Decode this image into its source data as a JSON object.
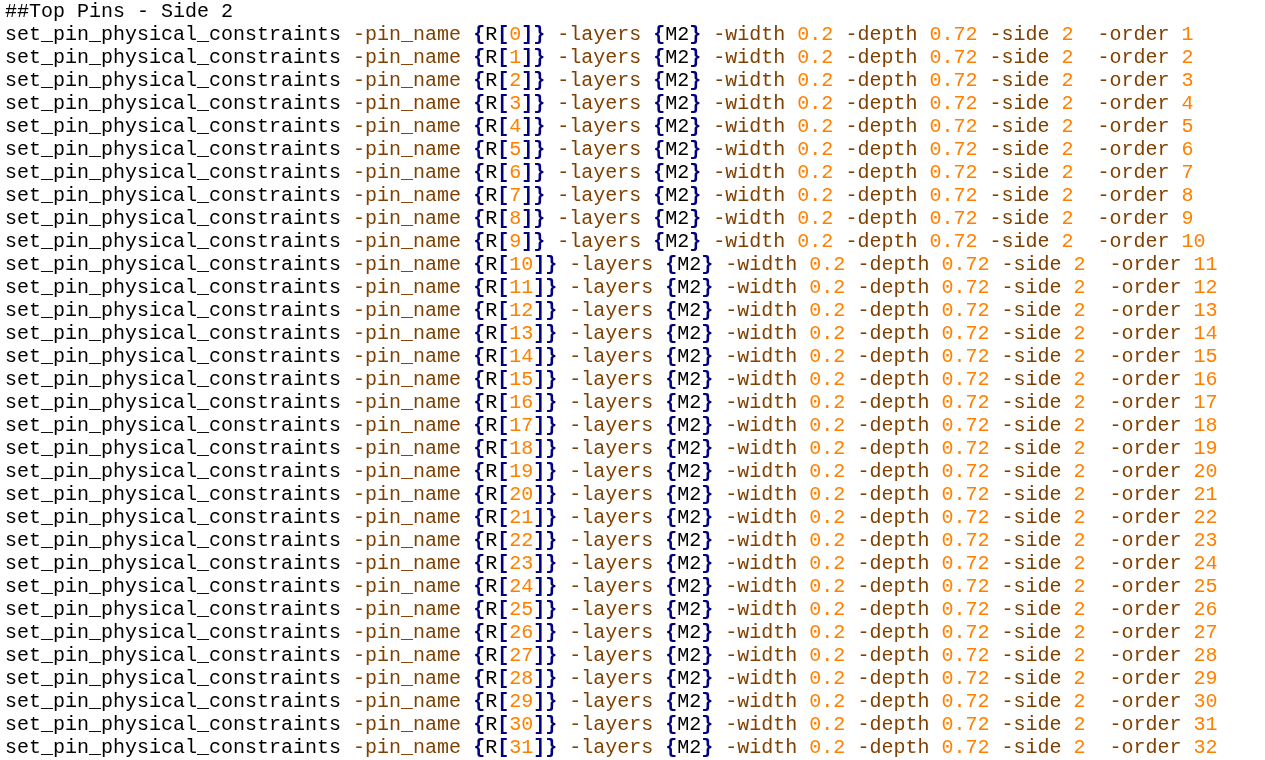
{
  "editor": {
    "lines": [
      {
        "kind": "comment",
        "text": "##Top Pins - Side 2"
      },
      {
        "kind": "command",
        "text": "set_pin_physical_constraints -pin_name {R[0]} -layers {M2} -width 0.2 -depth 0.72 -side 2  -order 1"
      },
      {
        "kind": "command",
        "text": "set_pin_physical_constraints -pin_name {R[1]} -layers {M2} -width 0.2 -depth 0.72 -side 2  -order 2"
      },
      {
        "kind": "command",
        "text": "set_pin_physical_constraints -pin_name {R[2]} -layers {M2} -width 0.2 -depth 0.72 -side 2  -order 3"
      },
      {
        "kind": "command",
        "text": "set_pin_physical_constraints -pin_name {R[3]} -layers {M2} -width 0.2 -depth 0.72 -side 2  -order 4"
      },
      {
        "kind": "command",
        "text": "set_pin_physical_constraints -pin_name {R[4]} -layers {M2} -width 0.2 -depth 0.72 -side 2  -order 5"
      },
      {
        "kind": "command",
        "text": "set_pin_physical_constraints -pin_name {R[5]} -layers {M2} -width 0.2 -depth 0.72 -side 2  -order 6"
      },
      {
        "kind": "command",
        "text": "set_pin_physical_constraints -pin_name {R[6]} -layers {M2} -width 0.2 -depth 0.72 -side 2  -order 7"
      },
      {
        "kind": "command",
        "text": "set_pin_physical_constraints -pin_name {R[7]} -layers {M2} -width 0.2 -depth 0.72 -side 2  -order 8"
      },
      {
        "kind": "command",
        "text": "set_pin_physical_constraints -pin_name {R[8]} -layers {M2} -width 0.2 -depth 0.72 -side 2  -order 9"
      },
      {
        "kind": "command",
        "text": "set_pin_physical_constraints -pin_name {R[9]} -layers {M2} -width 0.2 -depth 0.72 -side 2  -order 10"
      },
      {
        "kind": "command",
        "text": "set_pin_physical_constraints -pin_name {R[10]} -layers {M2} -width 0.2 -depth 0.72 -side 2  -order 11"
      },
      {
        "kind": "command",
        "text": "set_pin_physical_constraints -pin_name {R[11]} -layers {M2} -width 0.2 -depth 0.72 -side 2  -order 12"
      },
      {
        "kind": "command",
        "text": "set_pin_physical_constraints -pin_name {R[12]} -layers {M2} -width 0.2 -depth 0.72 -side 2  -order 13"
      },
      {
        "kind": "command",
        "text": "set_pin_physical_constraints -pin_name {R[13]} -layers {M2} -width 0.2 -depth 0.72 -side 2  -order 14"
      },
      {
        "kind": "command",
        "text": "set_pin_physical_constraints -pin_name {R[14]} -layers {M2} -width 0.2 -depth 0.72 -side 2  -order 15"
      },
      {
        "kind": "command",
        "text": "set_pin_physical_constraints -pin_name {R[15]} -layers {M2} -width 0.2 -depth 0.72 -side 2  -order 16"
      },
      {
        "kind": "command",
        "text": "set_pin_physical_constraints -pin_name {R[16]} -layers {M2} -width 0.2 -depth 0.72 -side 2  -order 17"
      },
      {
        "kind": "command",
        "text": "set_pin_physical_constraints -pin_name {R[17]} -layers {M2} -width 0.2 -depth 0.72 -side 2  -order 18"
      },
      {
        "kind": "command",
        "text": "set_pin_physical_constraints -pin_name {R[18]} -layers {M2} -width 0.2 -depth 0.72 -side 2  -order 19"
      },
      {
        "kind": "command",
        "text": "set_pin_physical_constraints -pin_name {R[19]} -layers {M2} -width 0.2 -depth 0.72 -side 2  -order 20"
      },
      {
        "kind": "command",
        "text": "set_pin_physical_constraints -pin_name {R[20]} -layers {M2} -width 0.2 -depth 0.72 -side 2  -order 21"
      },
      {
        "kind": "command",
        "text": "set_pin_physical_constraints -pin_name {R[21]} -layers {M2} -width 0.2 -depth 0.72 -side 2  -order 22"
      },
      {
        "kind": "command",
        "text": "set_pin_physical_constraints -pin_name {R[22]} -layers {M2} -width 0.2 -depth 0.72 -side 2  -order 23"
      },
      {
        "kind": "command",
        "text": "set_pin_physical_constraints -pin_name {R[23]} -layers {M2} -width 0.2 -depth 0.72 -side 2  -order 24"
      },
      {
        "kind": "command",
        "text": "set_pin_physical_constraints -pin_name {R[24]} -layers {M2} -width 0.2 -depth 0.72 -side 2  -order 25"
      },
      {
        "kind": "command",
        "text": "set_pin_physical_constraints -pin_name {R[25]} -layers {M2} -width 0.2 -depth 0.72 -side 2  -order 26"
      },
      {
        "kind": "command",
        "text": "set_pin_physical_constraints -pin_name {R[26]} -layers {M2} -width 0.2 -depth 0.72 -side 2  -order 27"
      },
      {
        "kind": "command",
        "text": "set_pin_physical_constraints -pin_name {R[27]} -layers {M2} -width 0.2 -depth 0.72 -side 2  -order 28"
      },
      {
        "kind": "command",
        "text": "set_pin_physical_constraints -pin_name {R[28]} -layers {M2} -width 0.2 -depth 0.72 -side 2  -order 29"
      },
      {
        "kind": "command",
        "text": "set_pin_physical_constraints -pin_name {R[29]} -layers {M2} -width 0.2 -depth 0.72 -side 2  -order 30"
      },
      {
        "kind": "command",
        "text": "set_pin_physical_constraints -pin_name {R[30]} -layers {M2} -width 0.2 -depth 0.72 -side 2  -order 31"
      },
      {
        "kind": "command",
        "text": "set_pin_physical_constraints -pin_name {R[31]} -layers {M2} -width 0.2 -depth 0.72 -side 2  -order 32"
      }
    ]
  }
}
